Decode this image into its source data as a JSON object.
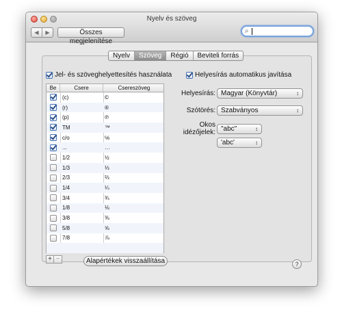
{
  "window": {
    "title": "Nyelv és szöveg"
  },
  "toolbar": {
    "back_glyph": "◀",
    "forward_glyph": "▶",
    "show_all_label": "Összes megjelenítése",
    "search_value": ""
  },
  "tabs": [
    {
      "label": "Nyelv",
      "active": false
    },
    {
      "label": "Szöveg",
      "active": true
    },
    {
      "label": "Régió",
      "active": false
    },
    {
      "label": "Beviteli forrás",
      "active": false
    }
  ],
  "substitution": {
    "enabled": true,
    "label": "Jel- és szöveghelyettesítés használata",
    "columns": {
      "on": "Be",
      "replace": "Csere",
      "with": "Csereszöveg"
    },
    "rows": [
      {
        "on": true,
        "replace": "(c)",
        "with": "©"
      },
      {
        "on": true,
        "replace": "(r)",
        "with": "®"
      },
      {
        "on": true,
        "replace": "(p)",
        "with": "℗"
      },
      {
        "on": true,
        "replace": "TM",
        "with": "™"
      },
      {
        "on": true,
        "replace": "c/o",
        "with": "℅"
      },
      {
        "on": true,
        "replace": "...",
        "with": "…"
      },
      {
        "on": false,
        "replace": "1/2",
        "with": "½"
      },
      {
        "on": false,
        "replace": "1/3",
        "with": "⅓"
      },
      {
        "on": false,
        "replace": "2/3",
        "with": "⅔"
      },
      {
        "on": false,
        "replace": "1/4",
        "with": "¼"
      },
      {
        "on": false,
        "replace": "3/4",
        "with": "¾"
      },
      {
        "on": false,
        "replace": "1/8",
        "with": "⅛"
      },
      {
        "on": false,
        "replace": "3/8",
        "with": "⅜"
      },
      {
        "on": false,
        "replace": "5/8",
        "with": "⅝"
      },
      {
        "on": false,
        "replace": "7/8",
        "with": "⅞"
      },
      {
        "on": null,
        "replace": "",
        "with": ""
      },
      {
        "on": null,
        "replace": "",
        "with": ""
      }
    ],
    "add_label": "+",
    "remove_label": "−",
    "reset_label": "Alapértékek visszaállítása"
  },
  "spelling": {
    "auto_correct_enabled": true,
    "auto_correct_label": "Helyesírás automatikus javítása",
    "spelling_label": "Helyesírás:",
    "spelling_value": "Magyar (Könyvtár)",
    "word_break_label": "Szótörés:",
    "word_break_value": "Szabványos",
    "smart_quotes_label_1": "Okos",
    "smart_quotes_label_2": "idézőjelek:",
    "double_quotes_value": "\"abc\"",
    "single_quotes_value": "'abc'"
  },
  "help_label": "?"
}
